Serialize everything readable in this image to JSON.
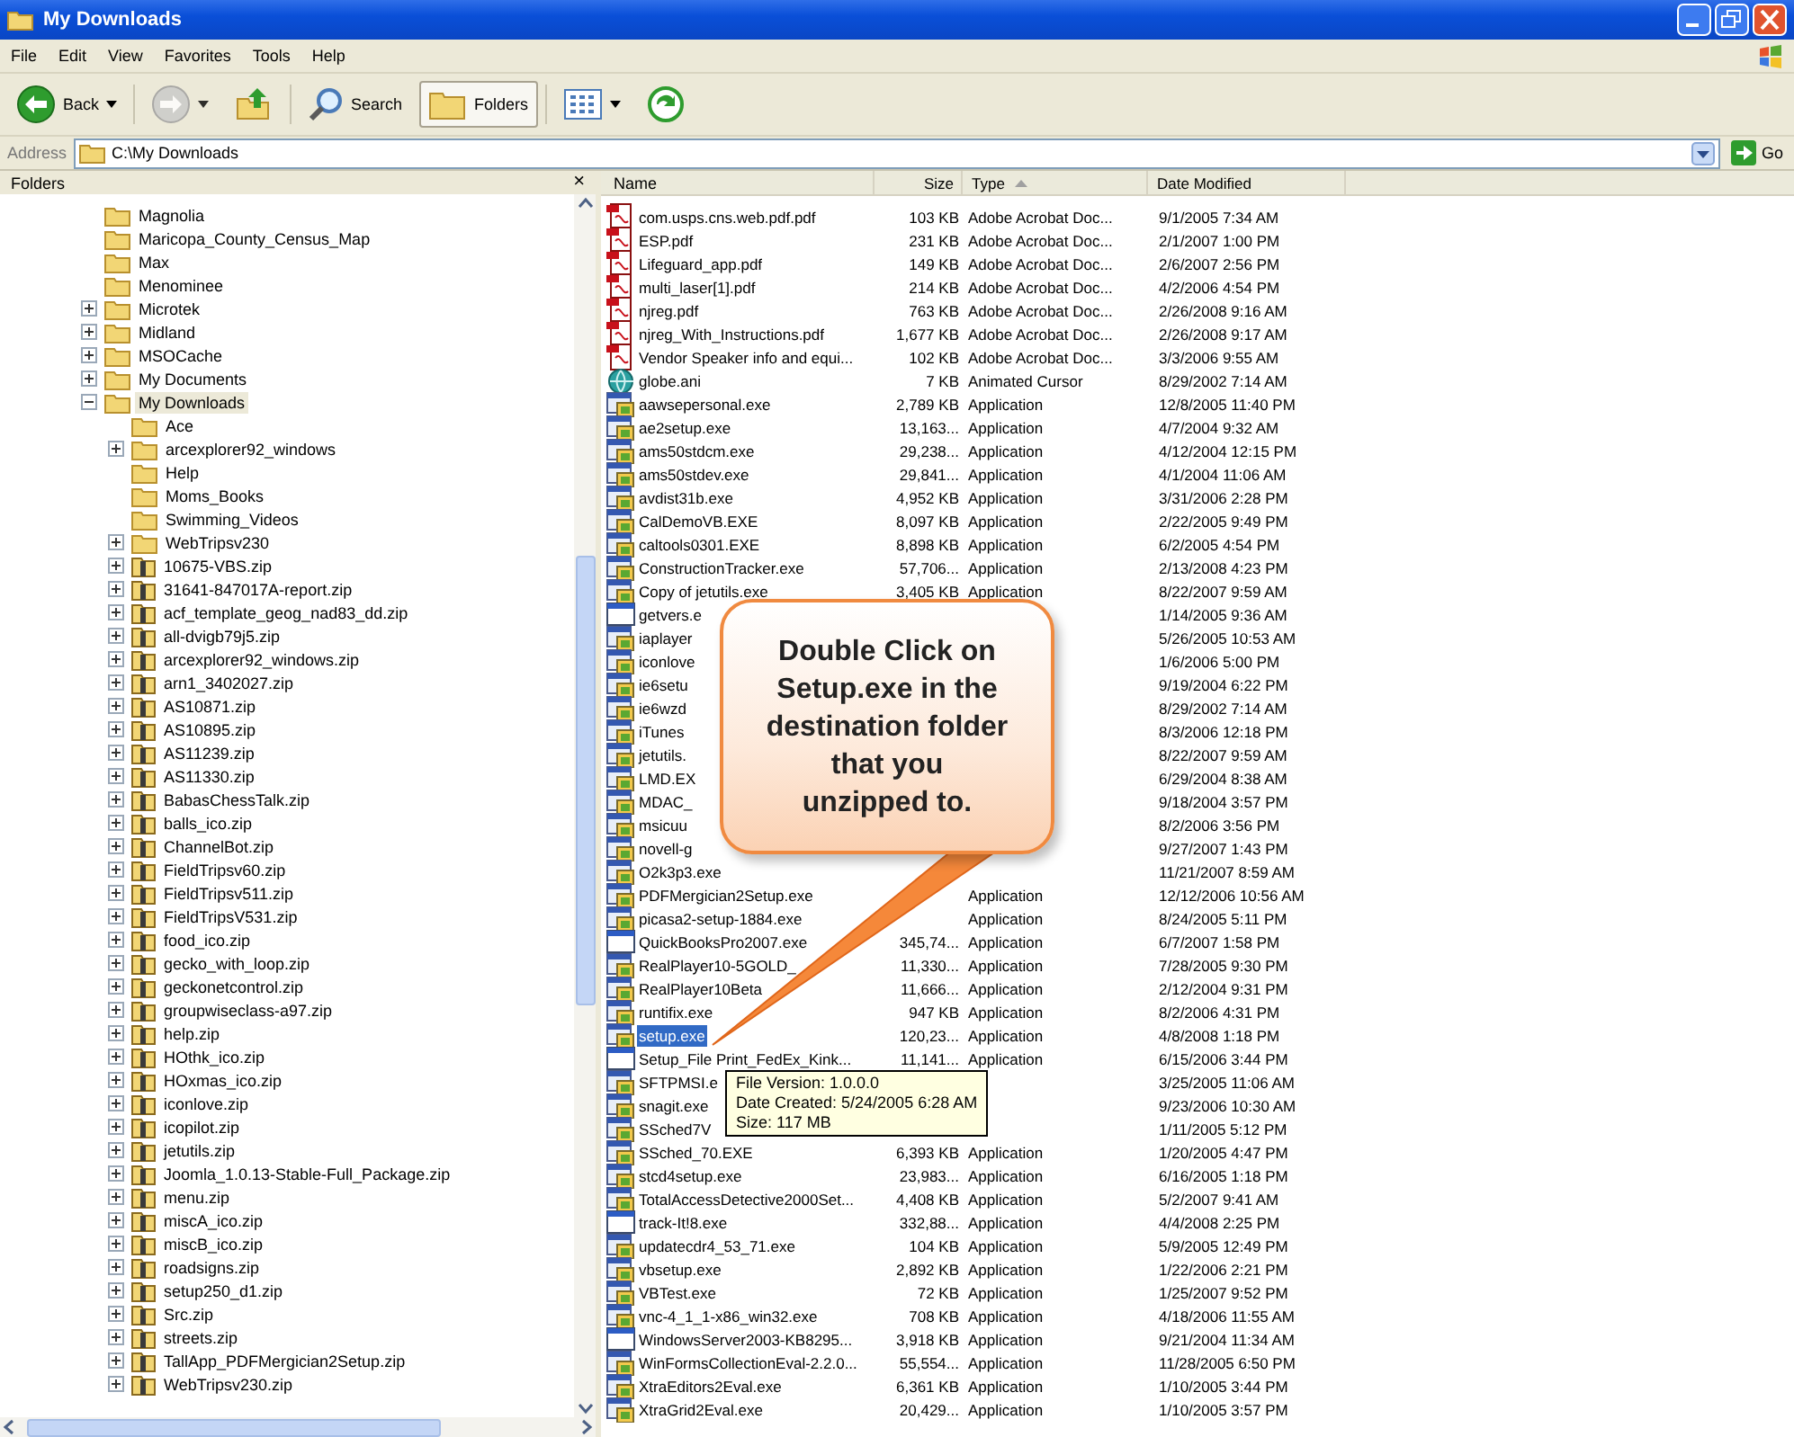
{
  "window": {
    "title": "My Downloads"
  },
  "menu": [
    "File",
    "Edit",
    "View",
    "Favorites",
    "Tools",
    "Help"
  ],
  "toolbar": [
    {
      "kind": "back",
      "label": "Back",
      "dropdown": true,
      "selected": false,
      "disabled": false
    },
    {
      "kind": "forward",
      "dropdown": true,
      "selected": false,
      "disabled": true
    },
    {
      "kind": "up",
      "dropdown": false,
      "selected": false,
      "disabled": false
    },
    {
      "kind": "search",
      "label": "Search",
      "dropdown": false,
      "selected": false,
      "disabled": false
    },
    {
      "kind": "folders",
      "label": "Folders",
      "dropdown": false,
      "selected": true,
      "disabled": false
    },
    {
      "kind": "views",
      "dropdown": true,
      "selected": false,
      "disabled": false
    },
    {
      "kind": "sync",
      "dropdown": false,
      "selected": false,
      "disabled": false
    }
  ],
  "address": {
    "label": "Address",
    "value": "C:\\My Downloads",
    "go": "Go"
  },
  "folders_pane": {
    "title": "Folders",
    "close": "×",
    "tree": [
      {
        "label": "Magnolia",
        "kind": "folder",
        "expandable": false,
        "selected": false
      },
      {
        "label": "Maricopa_County_Census_Map",
        "kind": "folder",
        "expandable": false,
        "selected": false
      },
      {
        "label": "Max",
        "kind": "folder",
        "expandable": false,
        "selected": false
      },
      {
        "label": "Menominee",
        "kind": "folder",
        "expandable": false,
        "selected": false
      },
      {
        "label": "Microtek",
        "kind": "folder",
        "expandable": true,
        "expanded": false,
        "selected": false
      },
      {
        "label": "Midland",
        "kind": "folder",
        "expandable": true,
        "expanded": false,
        "selected": false
      },
      {
        "label": "MSOCache",
        "kind": "folder",
        "expandable": true,
        "expanded": false,
        "selected": false
      },
      {
        "label": "My Documents",
        "kind": "folder",
        "expandable": true,
        "expanded": false,
        "selected": false
      },
      {
        "label": "My Downloads",
        "kind": "folder",
        "expandable": true,
        "expanded": true,
        "selected": true,
        "children": [
          {
            "label": "Ace",
            "kind": "folder",
            "expandable": false,
            "selected": false
          },
          {
            "label": "arcexplorer92_windows",
            "kind": "folder",
            "expandable": true,
            "expanded": false,
            "selected": false
          },
          {
            "label": "Help",
            "kind": "folder",
            "expandable": false,
            "selected": false
          },
          {
            "label": "Moms_Books",
            "kind": "folder",
            "expandable": false,
            "selected": false
          },
          {
            "label": "Swimming_Videos",
            "kind": "folder",
            "expandable": false,
            "selected": false
          },
          {
            "label": "WebTripsv230",
            "kind": "folder",
            "expandable": true,
            "expanded": false,
            "selected": false
          },
          {
            "label": "10675-VBS.zip",
            "kind": "zip",
            "expandable": true,
            "expanded": false,
            "selected": false
          },
          {
            "label": "31641-847017A-report.zip",
            "kind": "zip",
            "expandable": true,
            "expanded": false,
            "selected": false
          },
          {
            "label": "acf_template_geog_nad83_dd.zip",
            "kind": "zip",
            "expandable": true,
            "expanded": false,
            "selected": false
          },
          {
            "label": "all-dvigb79j5.zip",
            "kind": "zip",
            "expandable": true,
            "expanded": false,
            "selected": false
          },
          {
            "label": "arcexplorer92_windows.zip",
            "kind": "zip",
            "expandable": true,
            "expanded": false,
            "selected": false
          },
          {
            "label": "arn1_3402027.zip",
            "kind": "zip",
            "expandable": true,
            "expanded": false,
            "selected": false
          },
          {
            "label": "AS10871.zip",
            "kind": "zip",
            "expandable": true,
            "expanded": false,
            "selected": false
          },
          {
            "label": "AS10895.zip",
            "kind": "zip",
            "expandable": true,
            "expanded": false,
            "selected": false
          },
          {
            "label": "AS11239.zip",
            "kind": "zip",
            "expandable": true,
            "expanded": false,
            "selected": false
          },
          {
            "label": "AS11330.zip",
            "kind": "zip",
            "expandable": true,
            "expanded": false,
            "selected": false
          },
          {
            "label": "BabasChessTalk.zip",
            "kind": "zip",
            "expandable": true,
            "expanded": false,
            "selected": false
          },
          {
            "label": "balls_ico.zip",
            "kind": "zip",
            "expandable": true,
            "expanded": false,
            "selected": false
          },
          {
            "label": "ChannelBot.zip",
            "kind": "zip",
            "expandable": true,
            "expanded": false,
            "selected": false
          },
          {
            "label": "FieldTripsv60.zip",
            "kind": "zip",
            "expandable": true,
            "expanded": false,
            "selected": false
          },
          {
            "label": "FieldTripsv511.zip",
            "kind": "zip",
            "expandable": true,
            "expanded": false,
            "selected": false
          },
          {
            "label": "FieldTripsV531.zip",
            "kind": "zip",
            "expandable": true,
            "expanded": false,
            "selected": false
          },
          {
            "label": "food_ico.zip",
            "kind": "zip",
            "expandable": true,
            "expanded": false,
            "selected": false
          },
          {
            "label": "gecko_with_loop.zip",
            "kind": "zip",
            "expandable": true,
            "expanded": false,
            "selected": false
          },
          {
            "label": "geckonetcontrol.zip",
            "kind": "zip",
            "expandable": true,
            "expanded": false,
            "selected": false
          },
          {
            "label": "groupwiseclass-a97.zip",
            "kind": "zip",
            "expandable": true,
            "expanded": false,
            "selected": false
          },
          {
            "label": "help.zip",
            "kind": "zip",
            "expandable": true,
            "expanded": false,
            "selected": false
          },
          {
            "label": "HOthk_ico.zip",
            "kind": "zip",
            "expandable": true,
            "expanded": false,
            "selected": false
          },
          {
            "label": "HOxmas_ico.zip",
            "kind": "zip",
            "expandable": true,
            "expanded": false,
            "selected": false
          },
          {
            "label": "iconlove.zip",
            "kind": "zip",
            "expandable": true,
            "expanded": false,
            "selected": false
          },
          {
            "label": "icopilot.zip",
            "kind": "zip",
            "expandable": true,
            "expanded": false,
            "selected": false
          },
          {
            "label": "jetutils.zip",
            "kind": "zip",
            "expandable": true,
            "expanded": false,
            "selected": false
          },
          {
            "label": "Joomla_1.0.13-Stable-Full_Package.zip",
            "kind": "zip",
            "expandable": true,
            "expanded": false,
            "selected": false
          },
          {
            "label": "menu.zip",
            "kind": "zip",
            "expandable": true,
            "expanded": false,
            "selected": false
          },
          {
            "label": "miscA_ico.zip",
            "kind": "zip",
            "expandable": true,
            "expanded": false,
            "selected": false
          },
          {
            "label": "miscB_ico.zip",
            "kind": "zip",
            "expandable": true,
            "expanded": false,
            "selected": false
          },
          {
            "label": "roadsigns.zip",
            "kind": "zip",
            "expandable": true,
            "expanded": false,
            "selected": false
          },
          {
            "label": "setup250_d1.zip",
            "kind": "zip",
            "expandable": true,
            "expanded": false,
            "selected": false
          },
          {
            "label": "Src.zip",
            "kind": "zip",
            "expandable": true,
            "expanded": false,
            "selected": false
          },
          {
            "label": "streets.zip",
            "kind": "zip",
            "expandable": true,
            "expanded": false,
            "selected": false
          },
          {
            "label": "TallApp_PDFMergician2Setup.zip",
            "kind": "zip",
            "expandable": true,
            "expanded": false,
            "selected": false
          },
          {
            "label": "WebTripsv230.zip",
            "kind": "zip",
            "expandable": true,
            "expanded": false,
            "selected": false
          }
        ]
      }
    ]
  },
  "file_list": {
    "columns": [
      {
        "label": "Name",
        "sorted": false
      },
      {
        "label": "Size",
        "sorted": false
      },
      {
        "label": "Type",
        "sorted": true
      },
      {
        "label": "Date Modified",
        "sorted": false
      }
    ],
    "rows": [
      {
        "kind": "pdf",
        "name": "com.usps.cns.web.pdf.pdf",
        "size": "103 KB",
        "type": "Adobe Acrobat Doc...",
        "date": "9/1/2005 7:34 AM",
        "selected": false
      },
      {
        "kind": "pdf",
        "name": "ESP.pdf",
        "size": "231 KB",
        "type": "Adobe Acrobat Doc...",
        "date": "2/1/2007 1:00 PM",
        "selected": false
      },
      {
        "kind": "pdf",
        "name": "Lifeguard_app.pdf",
        "size": "149 KB",
        "type": "Adobe Acrobat Doc...",
        "date": "2/6/2007 2:56 PM",
        "selected": false
      },
      {
        "kind": "pdf",
        "name": "multi_laser[1].pdf",
        "size": "214 KB",
        "type": "Adobe Acrobat Doc...",
        "date": "4/2/2006 4:54 PM",
        "selected": false
      },
      {
        "kind": "pdf",
        "name": "njreg.pdf",
        "size": "763 KB",
        "type": "Adobe Acrobat Doc...",
        "date": "2/26/2008 9:16 AM",
        "selected": false
      },
      {
        "kind": "pdf",
        "name": "njreg_With_Instructions.pdf",
        "size": "1,677 KB",
        "type": "Adobe Acrobat Doc...",
        "date": "2/26/2008 9:17 AM",
        "selected": false
      },
      {
        "kind": "pdf",
        "name": "Vendor Speaker info and equi...",
        "size": "102 KB",
        "type": "Adobe Acrobat Doc...",
        "date": "3/3/2006 9:55 AM",
        "selected": false
      },
      {
        "kind": "cursor",
        "name": "globe.ani",
        "size": "7 KB",
        "type": "Animated Cursor",
        "date": "8/29/2002 7:14 AM",
        "selected": false
      },
      {
        "kind": "app",
        "name": "aawsepersonal.exe",
        "size": "2,789 KB",
        "type": "Application",
        "date": "12/8/2005 11:40 PM",
        "selected": false
      },
      {
        "kind": "app",
        "name": "ae2setup.exe",
        "size": "13,163...",
        "type": "Application",
        "date": "4/7/2004 9:32 AM",
        "selected": false
      },
      {
        "kind": "app",
        "name": "ams50stdcm.exe",
        "size": "29,238...",
        "type": "Application",
        "date": "4/12/2004 12:15 PM",
        "selected": false
      },
      {
        "kind": "app",
        "name": "ams50stdev.exe",
        "size": "29,841...",
        "type": "Application",
        "date": "4/1/2004 11:06 AM",
        "selected": false
      },
      {
        "kind": "app",
        "name": "avdist31b.exe",
        "size": "4,952 KB",
        "type": "Application",
        "date": "3/31/2006 2:28 PM",
        "selected": false
      },
      {
        "kind": "app",
        "name": "CalDemoVB.EXE",
        "size": "8,097 KB",
        "type": "Application",
        "date": "2/22/2005 9:49 PM",
        "selected": false
      },
      {
        "kind": "app",
        "name": "caltools0301.EXE",
        "size": "8,898 KB",
        "type": "Application",
        "date": "6/2/2005 4:54 PM",
        "selected": false
      },
      {
        "kind": "app",
        "name": "ConstructionTracker.exe",
        "size": "57,706...",
        "type": "Application",
        "date": "2/13/2008 4:23 PM",
        "selected": false
      },
      {
        "kind": "app",
        "name": "Copy of jetutils.exe",
        "size": "3,405 KB",
        "type": "Application",
        "date": "8/22/2007 9:59 AM",
        "selected": false
      },
      {
        "kind": "window",
        "name": "getvers.e",
        "date": "1/14/2005 9:36 AM",
        "selected": false
      },
      {
        "kind": "app",
        "name": "iaplayer",
        "date": "5/26/2005 10:53 AM",
        "selected": false
      },
      {
        "kind": "app",
        "name": "iconlove",
        "date": "1/6/2006 5:00 PM",
        "selected": false
      },
      {
        "kind": "app",
        "name": "ie6setu",
        "date": "9/19/2004 6:22 PM",
        "selected": false
      },
      {
        "kind": "app",
        "name": "ie6wzd",
        "date": "8/29/2002 7:14 AM",
        "selected": false
      },
      {
        "kind": "app",
        "name": "iTunes",
        "date": "8/3/2006 12:18 PM",
        "selected": false
      },
      {
        "kind": "app",
        "name": "jetutils.",
        "date": "8/22/2007 9:59 AM",
        "selected": false
      },
      {
        "kind": "app",
        "name": "LMD.EX",
        "date": "6/29/2004 8:38 AM",
        "selected": false
      },
      {
        "kind": "app",
        "name": "MDAC_",
        "date": "9/18/2004 3:57 PM",
        "selected": false
      },
      {
        "kind": "app",
        "name": "msicuu",
        "date": "8/2/2006 3:56 PM",
        "selected": false
      },
      {
        "kind": "app",
        "name": "novell-g",
        "date": "9/27/2007 1:43 PM",
        "selected": false
      },
      {
        "kind": "app",
        "name": "O2k3p3.exe",
        "date": "11/21/2007 8:59 AM",
        "selected": false
      },
      {
        "kind": "app",
        "name": "PDFMergician2Setup.exe",
        "type": "Application",
        "date": "12/12/2006 10:56 AM",
        "selected": false
      },
      {
        "kind": "app",
        "name": "picasa2-setup-1884.exe",
        "type": "Application",
        "date": "8/24/2005 5:11 PM",
        "selected": false
      },
      {
        "kind": "window",
        "name": "QuickBooksPro2007.exe",
        "size": "345,74...",
        "type": "Application",
        "date": "6/7/2007 1:58 PM",
        "selected": false
      },
      {
        "kind": "app",
        "name": "RealPlayer10-5GOLD_",
        "size": "11,330...",
        "type": "Application",
        "date": "7/28/2005 9:30 PM",
        "selected": false
      },
      {
        "kind": "app",
        "name": "RealPlayer10Beta",
        "size": "11,666...",
        "type": "Application",
        "date": "2/12/2004 9:31 PM",
        "selected": false
      },
      {
        "kind": "app",
        "name": "runtifix.exe",
        "size": "947 KB",
        "type": "Application",
        "date": "8/2/2006 4:31 PM",
        "selected": false
      },
      {
        "kind": "app",
        "name": "setup.exe",
        "size": "120,23...",
        "type": "Application",
        "date": "4/8/2008 1:18 PM",
        "selected": true
      },
      {
        "kind": "window",
        "name": "Setup_File Print_FedEx_Kink...",
        "size": "11,141...",
        "type": "Application",
        "date": "6/15/2006 3:44 PM",
        "selected": false
      },
      {
        "kind": "app",
        "name": "SFTPMSI.e",
        "date": "3/25/2005 11:06 AM",
        "selected": false
      },
      {
        "kind": "app",
        "name": "snagit.exe",
        "date": "9/23/2006 10:30 AM",
        "selected": false
      },
      {
        "kind": "app",
        "name": "SSched7V",
        "date": "1/11/2005 5:12 PM",
        "selected": false
      },
      {
        "kind": "app",
        "name": "SSched_70.EXE",
        "size": "6,393 KB",
        "type": "Application",
        "date": "1/20/2005 4:47 PM",
        "selected": false
      },
      {
        "kind": "app",
        "name": "stcd4setup.exe",
        "size": "23,983...",
        "type": "Application",
        "date": "6/16/2005 1:18 PM",
        "selected": false
      },
      {
        "kind": "app",
        "name": "TotalAccessDetective2000Set...",
        "size": "4,408 KB",
        "type": "Application",
        "date": "5/2/2007 9:41 AM",
        "selected": false
      },
      {
        "kind": "window",
        "name": "track-It!8.exe",
        "size": "332,88...",
        "type": "Application",
        "date": "4/4/2008 2:25 PM",
        "selected": false
      },
      {
        "kind": "app",
        "name": "updatecdr4_53_71.exe",
        "size": "104 KB",
        "type": "Application",
        "date": "5/9/2005 12:49 PM",
        "selected": false
      },
      {
        "kind": "app",
        "name": "vbsetup.exe",
        "size": "2,892 KB",
        "type": "Application",
        "date": "1/22/2006 2:21 PM",
        "selected": false
      },
      {
        "kind": "app",
        "name": "VBTest.exe",
        "size": "72 KB",
        "type": "Application",
        "date": "1/25/2007 9:52 PM",
        "selected": false
      },
      {
        "kind": "app",
        "name": "vnc-4_1_1-x86_win32.exe",
        "size": "708 KB",
        "type": "Application",
        "date": "4/18/2006 11:55 AM",
        "selected": false
      },
      {
        "kind": "window",
        "name": "WindowsServer2003-KB8295...",
        "size": "3,918 KB",
        "type": "Application",
        "date": "9/21/2004 11:34 AM",
        "selected": false
      },
      {
        "kind": "app",
        "name": "WinFormsCollectionEval-2.2.0...",
        "size": "55,554...",
        "type": "Application",
        "date": "11/28/2005 6:50 PM",
        "selected": false
      },
      {
        "kind": "app",
        "name": "XtraEditors2Eval.exe",
        "size": "6,361 KB",
        "type": "Application",
        "date": "1/10/2005 3:44 PM",
        "selected": false
      },
      {
        "kind": "app",
        "name": "XtraGrid2Eval.exe",
        "size": "20,429...",
        "type": "Application",
        "date": "1/10/2005 3:57 PM",
        "selected": false
      }
    ]
  },
  "tooltip": [
    "File Version: 1.0.0.0",
    "Date Created: 5/24/2005 6:28 AM",
    "Size: 117 MB"
  ],
  "callout": {
    "text": "Double Click on Setup.exe in the destination folder that you unzipped to."
  }
}
